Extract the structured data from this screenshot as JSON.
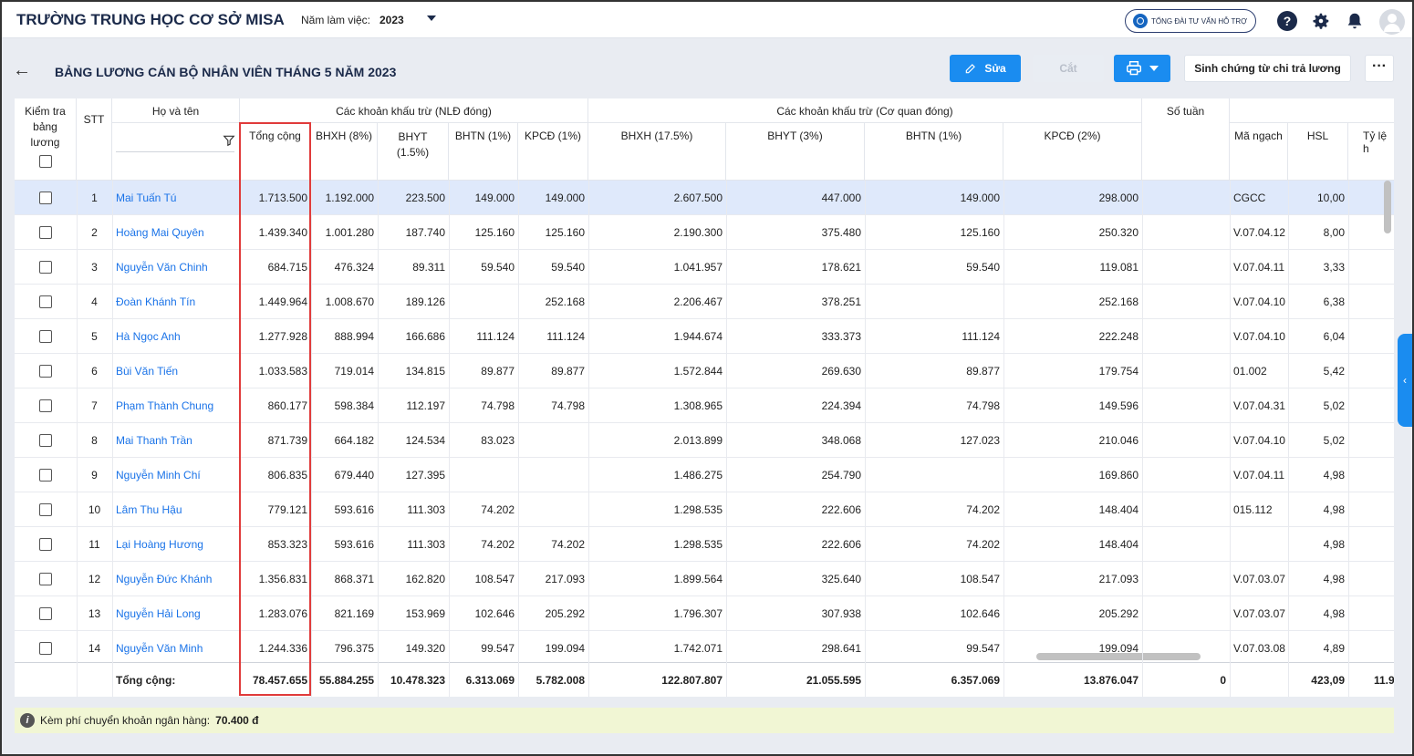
{
  "app": {
    "school": "TRƯỜNG TRUNG HỌC CƠ SỞ MISA",
    "year_label": "Năm làm việc:",
    "year_value": "2023",
    "hotline": "TỔNG ĐÀI TƯ VẤN HỖ TRỢ",
    "help": "?"
  },
  "page": {
    "title": "BẢNG LƯƠNG CÁN BỘ NHÂN VIÊN THÁNG 5 NĂM 2023",
    "edit_label": "Sửa",
    "cut_label": "Cắt",
    "generate_label": "Sinh chứng từ chi trả lương",
    "more_label": "···"
  },
  "table": {
    "headers": {
      "check": "Kiểm tra bảng lương",
      "stt": "STT",
      "name": "Họ và tên",
      "group_emp": "Các khoản khấu trừ (NLĐ đóng)",
      "group_org": "Các khoản khấu trừ (Cơ quan đóng)",
      "weeks": "Số tuần",
      "total": "Tổng cộng",
      "bhxh8": "BHXH (8%)",
      "bhyt15": "BHYT (1.5%)",
      "bhtn1": "BHTN (1%)",
      "kpcd1": "KPCĐ (1%)",
      "bhxh175": "BHXH (17.5%)",
      "bhyt3": "BHYT (3%)",
      "bhtn1b": "BHTN (1%)",
      "kpcd2": "KPCĐ (2%)",
      "rank": "Mã ngạch",
      "hsl": "HSL",
      "ratio": "Tỷ lệ h"
    },
    "rows": [
      {
        "stt": "1",
        "name": "Mai Tuấn Tú",
        "total": "1.713.500",
        "bhxh8": "1.192.000",
        "bhyt15": "223.500",
        "bhtn1": "149.000",
        "kpcd1": "149.000",
        "bhxh175": "2.607.500",
        "bhyt3": "447.000",
        "bhtn1b": "149.000",
        "kpcd2": "298.000",
        "rank": "CGCC",
        "hsl": "10,00"
      },
      {
        "stt": "2",
        "name": "Hoàng Mai Quyên",
        "total": "1.439.340",
        "bhxh8": "1.001.280",
        "bhyt15": "187.740",
        "bhtn1": "125.160",
        "kpcd1": "125.160",
        "bhxh175": "2.190.300",
        "bhyt3": "375.480",
        "bhtn1b": "125.160",
        "kpcd2": "250.320",
        "rank": "V.07.04.12",
        "hsl": "8,00"
      },
      {
        "stt": "3",
        "name": "Nguyễn Văn Chinh",
        "total": "684.715",
        "bhxh8": "476.324",
        "bhyt15": "89.311",
        "bhtn1": "59.540",
        "kpcd1": "59.540",
        "bhxh175": "1.041.957",
        "bhyt3": "178.621",
        "bhtn1b": "59.540",
        "kpcd2": "119.081",
        "rank": "V.07.04.11",
        "hsl": "3,33"
      },
      {
        "stt": "4",
        "name": "Đoàn Khánh Tín",
        "total": "1.449.964",
        "bhxh8": "1.008.670",
        "bhyt15": "189.126",
        "bhtn1": "",
        "kpcd1": "252.168",
        "bhxh175": "2.206.467",
        "bhyt3": "378.251",
        "bhtn1b": "",
        "kpcd2": "252.168",
        "rank": "V.07.04.10",
        "hsl": "6,38"
      },
      {
        "stt": "5",
        "name": "Hà Ngọc Anh",
        "total": "1.277.928",
        "bhxh8": "888.994",
        "bhyt15": "166.686",
        "bhtn1": "111.124",
        "kpcd1": "111.124",
        "bhxh175": "1.944.674",
        "bhyt3": "333.373",
        "bhtn1b": "111.124",
        "kpcd2": "222.248",
        "rank": "V.07.04.10",
        "hsl": "6,04"
      },
      {
        "stt": "6",
        "name": "Bùi Văn Tiến",
        "total": "1.033.583",
        "bhxh8": "719.014",
        "bhyt15": "134.815",
        "bhtn1": "89.877",
        "kpcd1": "89.877",
        "bhxh175": "1.572.844",
        "bhyt3": "269.630",
        "bhtn1b": "89.877",
        "kpcd2": "179.754",
        "rank": "01.002",
        "hsl": "5,42"
      },
      {
        "stt": "7",
        "name": "Phạm Thành Chung",
        "total": "860.177",
        "bhxh8": "598.384",
        "bhyt15": "112.197",
        "bhtn1": "74.798",
        "kpcd1": "74.798",
        "bhxh175": "1.308.965",
        "bhyt3": "224.394",
        "bhtn1b": "74.798",
        "kpcd2": "149.596",
        "rank": "V.07.04.31",
        "hsl": "5,02"
      },
      {
        "stt": "8",
        "name": "Mai Thanh Trần",
        "total": "871.739",
        "bhxh8": "664.182",
        "bhyt15": "124.534",
        "bhtn1": "83.023",
        "kpcd1": "",
        "bhxh175": "2.013.899",
        "bhyt3": "348.068",
        "bhtn1b": "127.023",
        "kpcd2": "210.046",
        "rank": "V.07.04.10",
        "hsl": "5,02"
      },
      {
        "stt": "9",
        "name": "Nguyễn Minh Chí",
        "total": "806.835",
        "bhxh8": "679.440",
        "bhyt15": "127.395",
        "bhtn1": "",
        "kpcd1": "",
        "bhxh175": "1.486.275",
        "bhyt3": "254.790",
        "bhtn1b": "",
        "kpcd2": "169.860",
        "rank": "V.07.04.11",
        "hsl": "4,98"
      },
      {
        "stt": "10",
        "name": "Lâm Thu Hậu",
        "total": "779.121",
        "bhxh8": "593.616",
        "bhyt15": "111.303",
        "bhtn1": "74.202",
        "kpcd1": "",
        "bhxh175": "1.298.535",
        "bhyt3": "222.606",
        "bhtn1b": "74.202",
        "kpcd2": "148.404",
        "rank": "015.112",
        "hsl": "4,98"
      },
      {
        "stt": "11",
        "name": "Lại Hoàng Hương",
        "total": "853.323",
        "bhxh8": "593.616",
        "bhyt15": "111.303",
        "bhtn1": "74.202",
        "kpcd1": "74.202",
        "bhxh175": "1.298.535",
        "bhyt3": "222.606",
        "bhtn1b": "74.202",
        "kpcd2": "148.404",
        "rank": "",
        "hsl": "4,98"
      },
      {
        "stt": "12",
        "name": "Nguyễn Đức Khánh",
        "total": "1.356.831",
        "bhxh8": "868.371",
        "bhyt15": "162.820",
        "bhtn1": "108.547",
        "kpcd1": "217.093",
        "bhxh175": "1.899.564",
        "bhyt3": "325.640",
        "bhtn1b": "108.547",
        "kpcd2": "217.093",
        "rank": "V.07.03.07",
        "hsl": "4,98"
      },
      {
        "stt": "13",
        "name": "Nguyễn Hải Long",
        "total": "1.283.076",
        "bhxh8": "821.169",
        "bhyt15": "153.969",
        "bhtn1": "102.646",
        "kpcd1": "205.292",
        "bhxh175": "1.796.307",
        "bhyt3": "307.938",
        "bhtn1b": "102.646",
        "kpcd2": "205.292",
        "rank": "V.07.03.07",
        "hsl": "4,98"
      },
      {
        "stt": "14",
        "name": "Nguyễn Văn Minh",
        "total": "1.244.336",
        "bhxh8": "796.375",
        "bhyt15": "149.320",
        "bhtn1": "99.547",
        "kpcd1": "199.094",
        "bhxh175": "1.742.071",
        "bhyt3": "298.641",
        "bhtn1b": "99.547",
        "kpcd2": "199.094",
        "rank": "V.07.03.08",
        "hsl": "4,89"
      }
    ],
    "footer": {
      "label": "Tổng cộng:",
      "total": "78.457.655",
      "bhxh8": "55.884.255",
      "bhyt15": "10.478.323",
      "bhtn1": "6.313.069",
      "kpcd1": "5.782.008",
      "bhxh175": "122.807.807",
      "bhyt3": "21.055.595",
      "bhtn1b": "6.357.069",
      "kpcd2": "13.876.047",
      "weeks": "0",
      "hsl": "423,09",
      "ratio": "11.9"
    }
  },
  "notice": {
    "text": "Kèm phí chuyển khoản ngân hàng:",
    "amount": "70.400 đ"
  }
}
